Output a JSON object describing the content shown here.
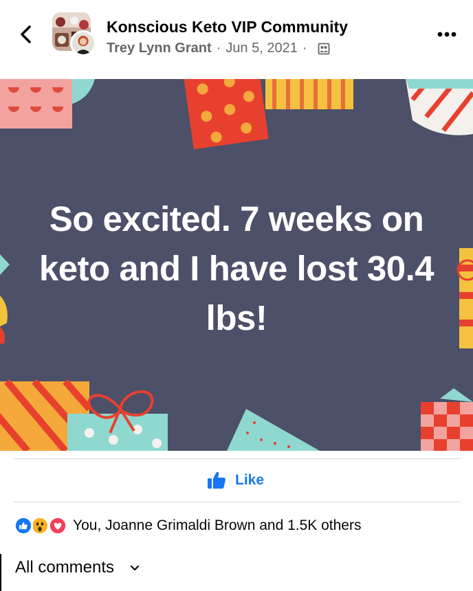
{
  "header": {
    "group_name": "Konscious Keto VIP Community",
    "author": "Trey Lynn Grant",
    "date": "Jun 5, 2021",
    "separator": "·",
    "audience_icon": "group-members-icon"
  },
  "post": {
    "line1": "So excited. 7 weeks on",
    "line2": "keto and I have lost 30.4",
    "line3": "lbs!",
    "background_color": "#4c5068"
  },
  "actions": {
    "like_label": "Like"
  },
  "reactions": {
    "icons": [
      "like-reaction-icon",
      "wow-reaction-icon",
      "love-reaction-icon"
    ],
    "summary": "You, Joanne Grimaldi Brown and 1.5K others"
  },
  "comments": {
    "filter_label": "All comments"
  },
  "colors": {
    "accent": "#1877f2",
    "secondary_text": "#65676b",
    "love": "#f33e58",
    "wow": "#f7b125"
  }
}
